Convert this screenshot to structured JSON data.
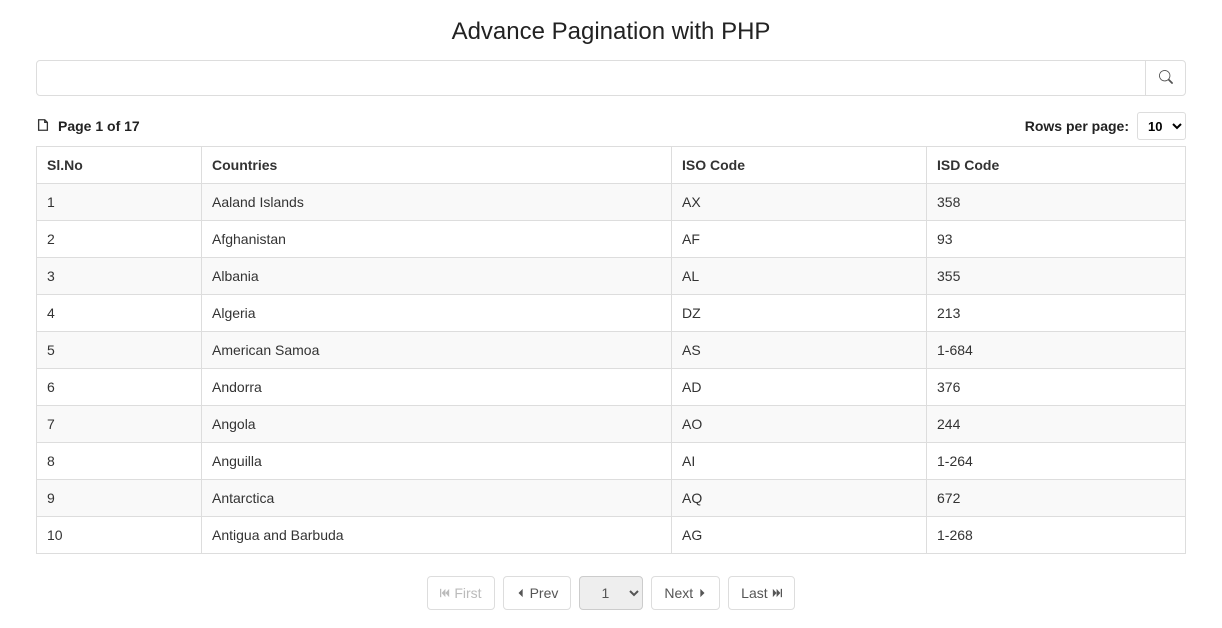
{
  "header": {
    "title": "Advance Pagination with PHP"
  },
  "search": {
    "value": "",
    "placeholder": ""
  },
  "info": {
    "page_label": "Page 1 of 17",
    "rows_label": "Rows per page:",
    "rows_value": "10"
  },
  "table": {
    "headers": [
      "Sl.No",
      "Countries",
      "ISO Code",
      "ISD Code"
    ],
    "rows": [
      {
        "slno": "1",
        "country": "Aaland Islands",
        "iso": "AX",
        "isd": "358"
      },
      {
        "slno": "2",
        "country": "Afghanistan",
        "iso": "AF",
        "isd": "93"
      },
      {
        "slno": "3",
        "country": "Albania",
        "iso": "AL",
        "isd": "355"
      },
      {
        "slno": "4",
        "country": "Algeria",
        "iso": "DZ",
        "isd": "213"
      },
      {
        "slno": "5",
        "country": "American Samoa",
        "iso": "AS",
        "isd": "1-684"
      },
      {
        "slno": "6",
        "country": "Andorra",
        "iso": "AD",
        "isd": "376"
      },
      {
        "slno": "7",
        "country": "Angola",
        "iso": "AO",
        "isd": "244"
      },
      {
        "slno": "8",
        "country": "Anguilla",
        "iso": "AI",
        "isd": "1-264"
      },
      {
        "slno": "9",
        "country": "Antarctica",
        "iso": "AQ",
        "isd": "672"
      },
      {
        "slno": "10",
        "country": "Antigua and Barbuda",
        "iso": "AG",
        "isd": "1-268"
      }
    ]
  },
  "pagination": {
    "first": "First",
    "prev": "Prev",
    "next": "Next",
    "last": "Last",
    "current": "1"
  }
}
